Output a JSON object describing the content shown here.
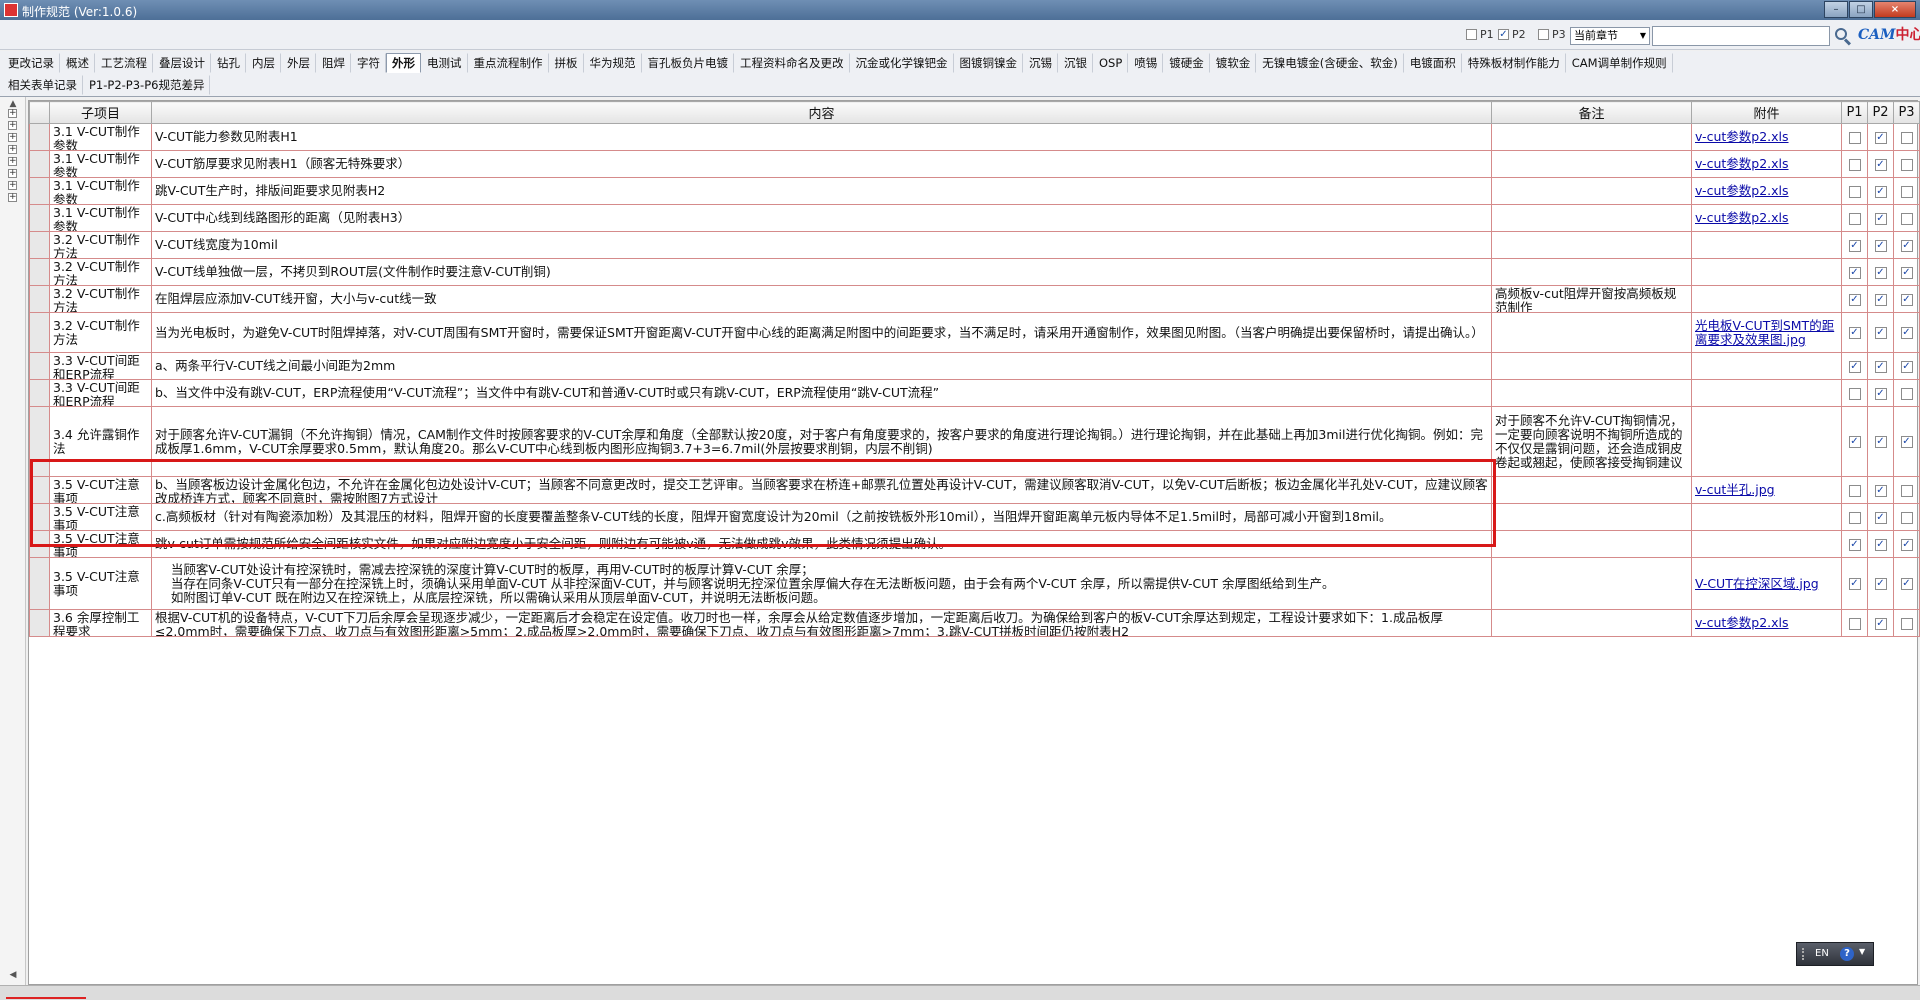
{
  "window": {
    "title": "制作规范 (Ver:1.0.6)"
  },
  "filters": {
    "p1": {
      "label": "P1",
      "checked": false
    },
    "p2": {
      "label": "P2",
      "checked": true
    },
    "p3": {
      "label": "P3",
      "checked": false
    },
    "scope_value": "当前章节",
    "search_value": "",
    "logo_text_en": "CAM",
    "logo_text_zh": "中心"
  },
  "tabs_row1": [
    "更改记录",
    "概述",
    "工艺流程",
    "叠层设计",
    "钻孔",
    "内层",
    "外层",
    "阻焊",
    "字符",
    "外形",
    "电测试",
    "重点流程制作",
    "拼板",
    "华为规范",
    "盲孔板负片电镀",
    "工程资料命名及更改",
    "沉金或化学镍钯金",
    "图镀铜镍金",
    "沉锡",
    "沉银",
    "OSP",
    "喷锡",
    "镀硬金",
    "镀软金",
    "无镍电镀金(含硬金、软金)",
    "电镀面积",
    "特殊板材制作能力",
    "CAM调单制作规则"
  ],
  "active_tab_index": 9,
  "tabs_row2": [
    "相关表单记录",
    "P1-P2-P3-P6规范差异"
  ],
  "table": {
    "headers": {
      "sub": "子项目",
      "content": "内容",
      "note": "备注",
      "attach": "附件",
      "p1": "P1",
      "p2": "P2",
      "p3": "P3"
    },
    "rows": [
      {
        "sub": "3.1 V-CUT制作参数",
        "content": "V-CUT能力参数见附表H1",
        "note": "",
        "attach": "v-cut参数p2.xls",
        "p1": false,
        "p2": true,
        "p3": false
      },
      {
        "sub": "3.1 V-CUT制作参数",
        "content": "V-CUT筋厚要求见附表H1（顾客无特殊要求）",
        "note": "",
        "attach": "v-cut参数p2.xls",
        "p1": false,
        "p2": true,
        "p3": false
      },
      {
        "sub": "3.1 V-CUT制作参数",
        "content": "跳V-CUT生产时，排版间距要求见附表H2",
        "note": "",
        "attach": "v-cut参数p2.xls",
        "p1": false,
        "p2": true,
        "p3": false
      },
      {
        "sub": "3.1 V-CUT制作参数",
        "content": "V-CUT中心线到线路图形的距离（见附表H3）",
        "note": "",
        "attach": "v-cut参数p2.xls",
        "p1": false,
        "p2": true,
        "p3": false
      },
      {
        "sub": "3.2 V-CUT制作方法",
        "content": "V-CUT线宽度为10mil",
        "note": "",
        "attach": "",
        "p1": true,
        "p2": true,
        "p3": true
      },
      {
        "sub": "3.2 V-CUT制作方法",
        "content": "V-CUT线单独做一层，不拷贝到ROUT层(文件制作时要注意V-CUT削铜)",
        "note": "",
        "attach": "",
        "p1": true,
        "p2": true,
        "p3": true
      },
      {
        "sub": "3.2 V-CUT制作方法",
        "content": "在阻焊层应添加V-CUT线开窗，大小与v-cut线一致",
        "note": "高频板v-cut阻焊开窗按高频板规范制作",
        "attach": "",
        "p1": true,
        "p2": true,
        "p3": true
      },
      {
        "sub": "3.2 V-CUT制作方法",
        "content": "当为光电板时，为避免V-CUT时阻焊掉落，对V-CUT周围有SMT开窗时，需要保证SMT开窗距离V-CUT开窗中心线的距离满足附图中的间距要求，当不满足时，请采用开通窗制作，效果图见附图。（当客户明确提出要保留桥时，请提出确认。）",
        "note": "",
        "attach": "光电板V-CUT到SMT的距离要求及效果图.jpg",
        "p1": true,
        "p2": true,
        "p3": true
      },
      {
        "sub": "3.3 V-CUT间距和ERP流程",
        "content": "a、两条平行V-CUT线之间最小间距为2mm",
        "note": "",
        "attach": "",
        "p1": true,
        "p2": true,
        "p3": true
      },
      {
        "sub": "3.3 V-CUT间距和ERP流程",
        "content": "b、当文件中没有跳V-CUT，ERP流程使用“V-CUT流程”；当文件中有跳V-CUT和普通V-CUT时或只有跳V-CUT，ERP流程使用“跳V-CUT流程”",
        "note": "",
        "attach": "",
        "p1": false,
        "p2": true,
        "p3": false
      },
      {
        "sub": "3.4 允许露铜作法",
        "content": "对于顾客允许V-CUT漏铜（不允许掏铜）情况，CAM制作文件时按顾客要求的V-CUT余厚和角度（全部默认按20度，对于客户有角度要求的，按客户要求的角度进行理论掏铜。）进行理论掏铜，并在此基础上再加3mil进行优化掏铜。例如：完成板厚1.6mm，V-CUT余厚要求0.5mm，默认角度20。那么V-CUT中心线到板内图形应掏铜3.7+3=6.7mil(外层按要求削铜，内层不削铜)",
        "note": "对于顾客不允许V-CUT掏铜情况，一定要向顾客说明不掏铜所造成的不仅仅是露铜问题，还会造成铜皮卷起或翘起，使顾客接受掏铜建议",
        "attach": "",
        "p1": true,
        "p2": true,
        "p3": true
      },
      {
        "sub": "3.5 V-CUT注意事项",
        "content": "b、当顾客板边设计金属化包边，不允许在金属化包边处设计V-CUT；当顾客不同意更改时，提交工艺评审。当顾客要求在桥连+邮票孔位置处再设计V-CUT，需建议顾客取消V-CUT，以免V-CUT后断板；板边金属化半孔处V-CUT，应建议顾客改成桥连方式，顾客不同意时，需按附图7方式设计",
        "note": "",
        "attach": "v-cut半孔.jpg",
        "p1": false,
        "p2": true,
        "p3": false
      },
      {
        "sub": "3.5 V-CUT注意事项",
        "content": "c.高频板材（针对有陶瓷添加粉）及其混压的材料，阻焊开窗的长度要覆盖整条V-CUT线的长度，阻焊开窗宽度设计为20mil（之前按铣板外形10mil），当阻焊开窗距离单元板内导体不足1.5mil时，局部可减小开窗到18mil。",
        "note": "",
        "attach": "",
        "p1": false,
        "p2": true,
        "p3": false
      },
      {
        "sub": "3.5 V-CUT注意事项",
        "content": "跳v-cut订单需按规范所给安全间距核实文件，如果对应附边宽度小于安全间距，则附边有可能被v通，无法做成跳v效果，此类情况须提出确认。",
        "note": "",
        "attach": "",
        "p1": true,
        "p2": true,
        "p3": true
      },
      {
        "sub": "3.5 V-CUT注意事项",
        "content": "    当顾客V-CUT处设计有控深铣时，需减去控深铣的深度计算V-CUT时的板厚，再用V-CUT时的板厚计算V-CUT 余厚；\n    当存在同条V-CUT只有一部分在控深铣上时，须确认采用单面V-CUT 从非控深面V-CUT，并与顾客说明无控深位置余厚偏大存在无法断板问题，由于会有两个V-CUT 余厚，所以需提供V-CUT 余厚图纸给到生产。\n    如附图订单V-CUT 既在附边又在控深铣上，从底层控深铣，所以需确认采用从顶层单面V-CUT，并说明无法断板问题。",
        "note": "",
        "attach": "V-CUT在控深区域.jpg",
        "p1": true,
        "p2": true,
        "p3": true
      },
      {
        "sub": "3.6 余厚控制工程要求",
        "content": "根据V-CUT机的设备特点，V-CUT下刀后余厚会呈现逐步减少，一定距离后才会稳定在设定值。收刀时也一样，余厚会从给定数值逐步增加，一定距离后收刀。为确保给到客户的板V-CUT余厚达到规定，工程设计要求如下：1.成品板厚≤2.0mm时，需要确保下刀点、收刀点与有效图形距离>5mm；2.成品板厚>2.0mm时，需要确保下刀点、收刀点与有效图形距离>7mm；3.跳V-CUT拼板时间距仍按附表H2",
        "note": "",
        "attach": "v-cut参数p2.xls",
        "p1": false,
        "p2": true,
        "p3": false
      }
    ]
  },
  "ime": {
    "lang": "EN",
    "help": "?"
  },
  "icons": {
    "search": "search-icon",
    "expand": "expand-plus-icon",
    "help": "help-icon"
  },
  "colors": {
    "highlight": "#d81818",
    "grid_border": "#d58b8b",
    "link": "#0a0aa8"
  }
}
